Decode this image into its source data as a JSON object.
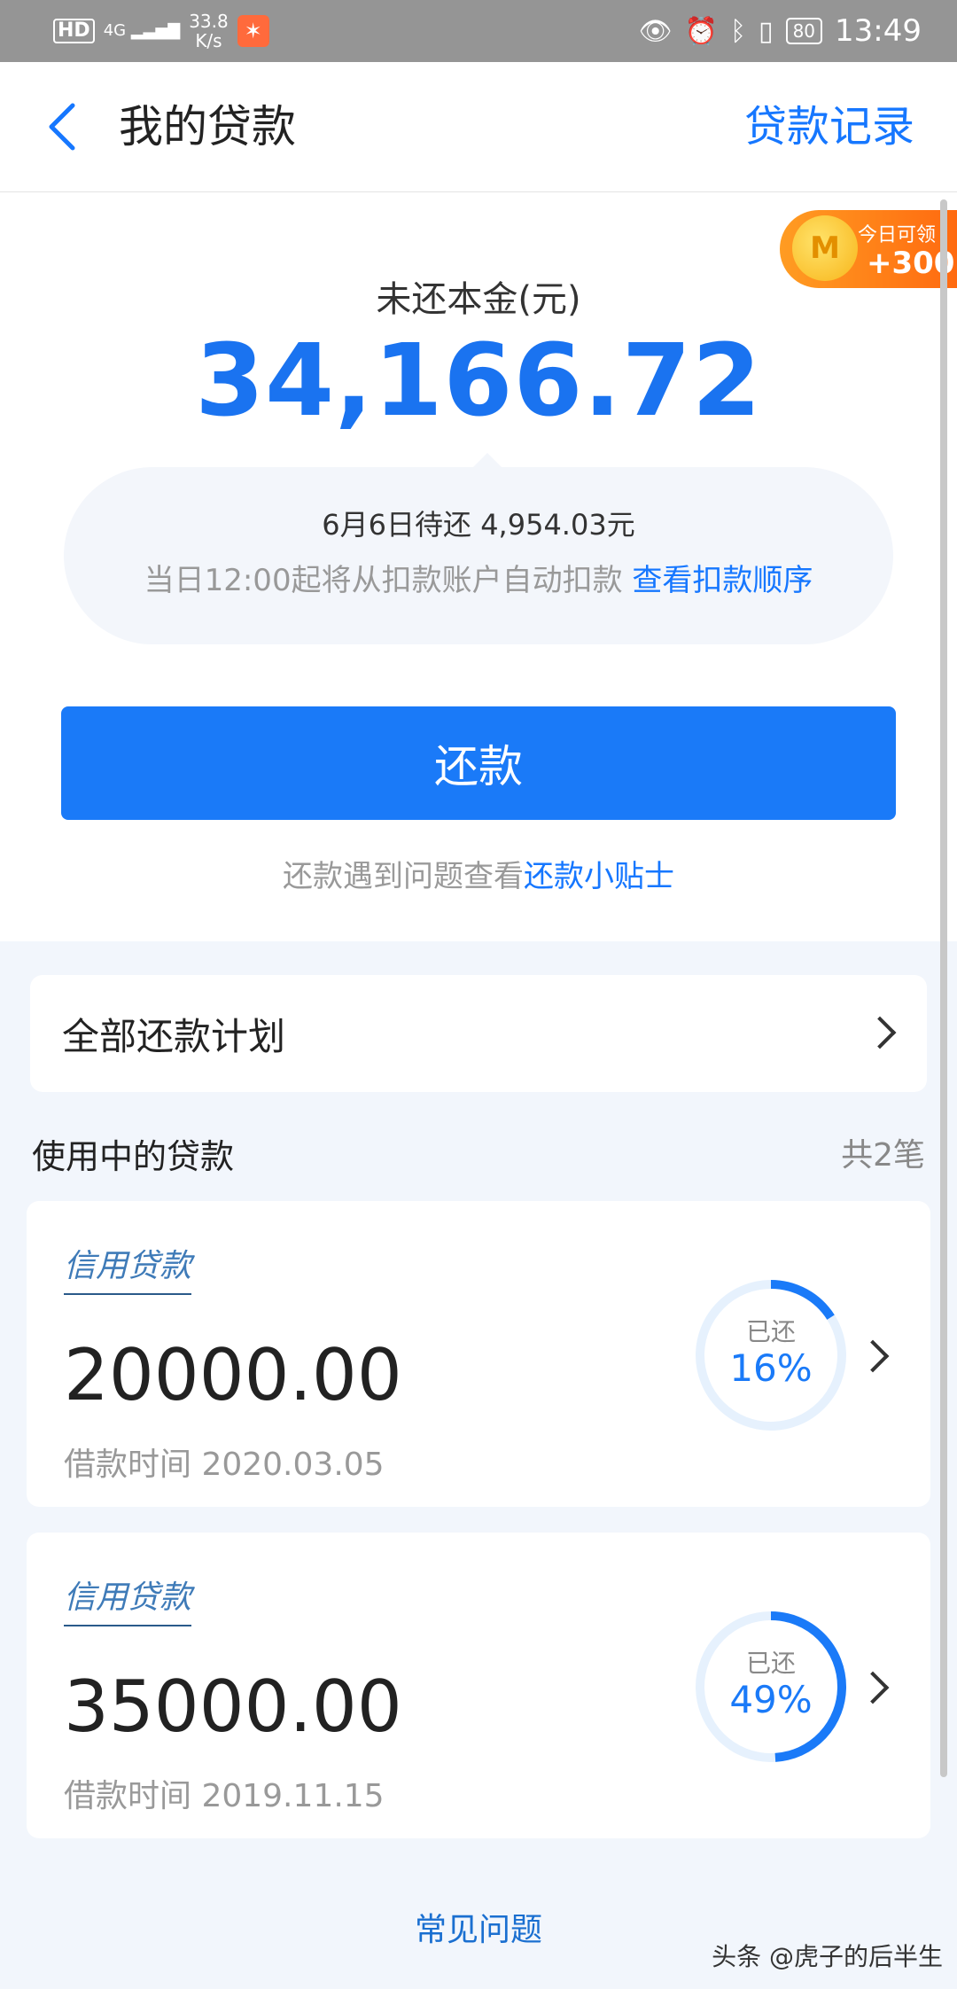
{
  "status_bar": {
    "hd": "HD",
    "network": "4G",
    "speed_value": "33.8",
    "speed_unit": "K/s",
    "battery": "80",
    "time": "13:49"
  },
  "header": {
    "title": "我的贷款",
    "record_link": "贷款记录"
  },
  "promo": {
    "label": "今日可领",
    "amount": "+300"
  },
  "summary": {
    "principal_label": "未还本金(元)",
    "principal_amount": "34,166.72",
    "due_text": "6月6日待还 4,954.03元",
    "auto_debit_text": "当日12:00起将从扣款账户自动扣款",
    "debit_order_link": "查看扣款顺序",
    "repay_button": "还款",
    "tip_text": "还款遇到问题查看",
    "tip_link": "还款小贴士"
  },
  "plan": {
    "label": "全部还款计划"
  },
  "loans": {
    "heading": "使用中的贷款",
    "count": "共2笔",
    "items": [
      {
        "type": "信用贷款",
        "amount": "20000.00",
        "date": "借款时间 2020.03.05",
        "repaid_label": "已还",
        "repaid_pct": "16%",
        "repaid_fraction": 0.16
      },
      {
        "type": "信用贷款",
        "amount": "35000.00",
        "date": "借款时间 2019.11.15",
        "repaid_label": "已还",
        "repaid_pct": "49%",
        "repaid_fraction": 0.49
      }
    ]
  },
  "footer": {
    "faq": "常见问题",
    "watermark": "头条 @虎子的后半生"
  },
  "colors": {
    "accent": "#1a7af8",
    "link": "#1677ff",
    "ring_track": "#e6f1fd",
    "promo": "#ff8a1a"
  }
}
